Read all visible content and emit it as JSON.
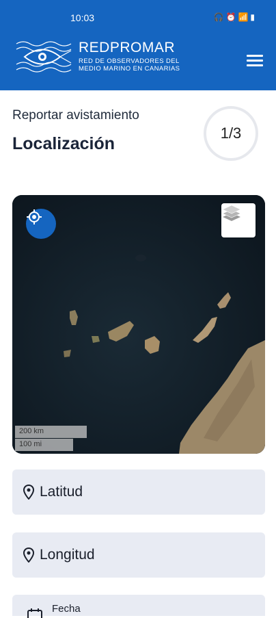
{
  "status_bar": {
    "time": "10:03",
    "icons": [
      "headphones-icon",
      "alarm-icon",
      "wifi-icon",
      "signal-icon",
      "battery-icon"
    ]
  },
  "header": {
    "brand_name": "REDPROMAR",
    "brand_subtitle_line1": "RED DE OBSERVADORES DEL",
    "brand_subtitle_line2": "MEDIO MARINO EN CANARIAS",
    "menu_icon": "hamburger-menu-icon"
  },
  "page": {
    "subtitle": "Reportar avistamiento",
    "title": "Localización",
    "step": "1/3"
  },
  "map": {
    "locate_icon": "crosshair-icon",
    "layers_icon": "layers-icon",
    "scale_km": "200 km",
    "scale_mi": "100 mi"
  },
  "form": {
    "latitude_label": "Latitud",
    "longitude_label": "Longitud",
    "date_label": "Fecha"
  },
  "colors": {
    "primary": "#1565C0",
    "field_bg": "#e8ebf3"
  }
}
